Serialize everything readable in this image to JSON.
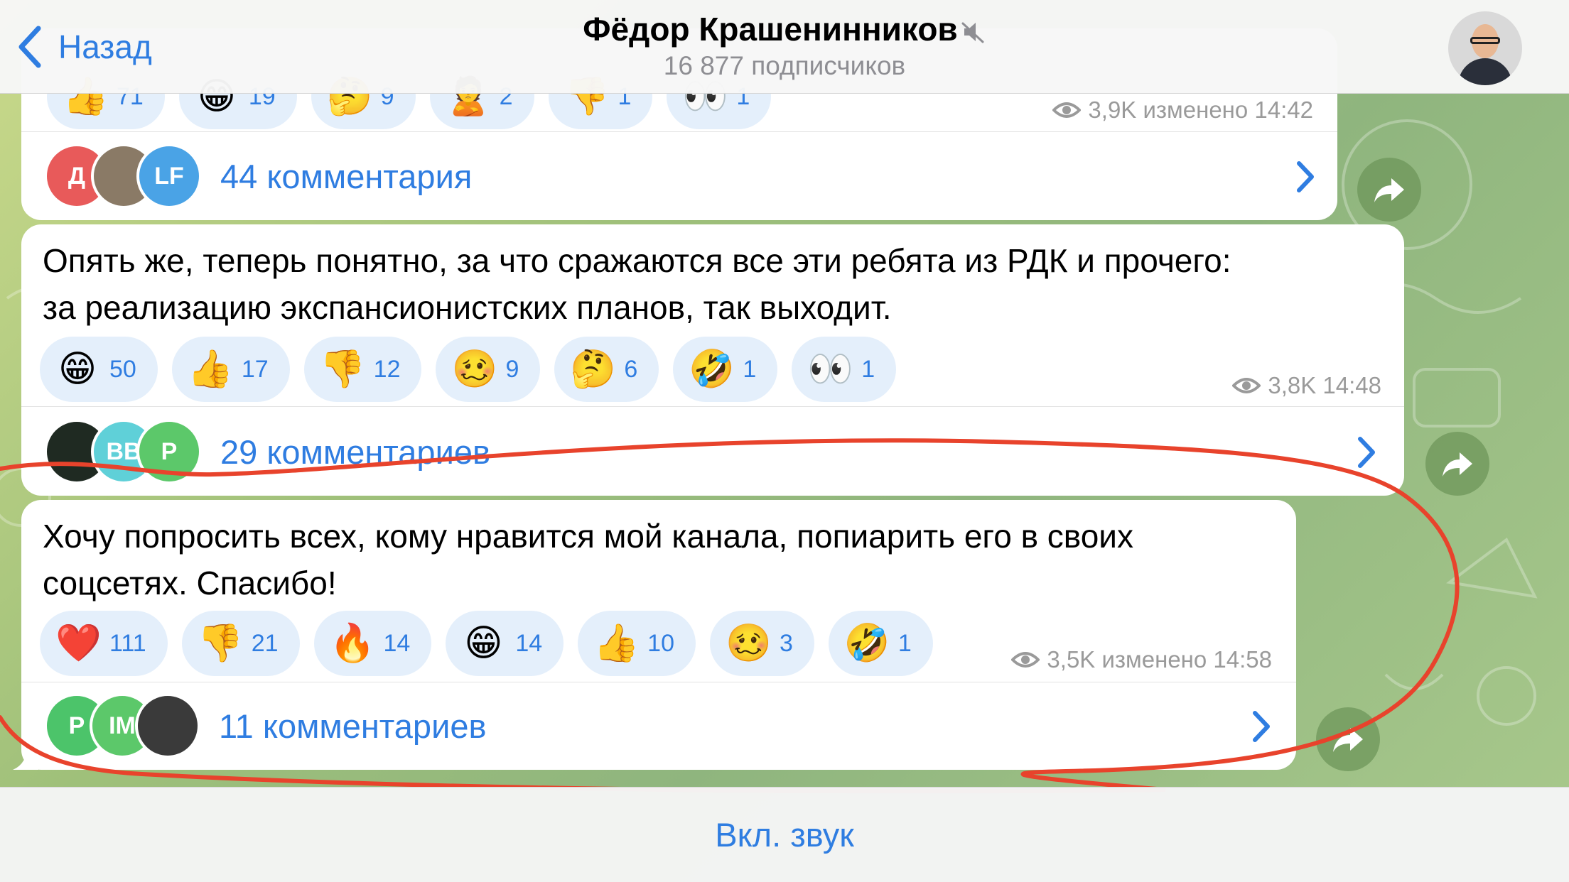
{
  "header": {
    "back_label": "Назад",
    "title": "Фёдор Крашенинников",
    "subtitle": "16 877 подписчиков",
    "muted_icon": "speaker-muted-icon"
  },
  "messages": [
    {
      "text_lines": [],
      "reactions": [
        {
          "emoji": "👍",
          "count": "71"
        },
        {
          "emoji": "😁",
          "count": "19"
        },
        {
          "emoji": "🤔",
          "count": "9"
        },
        {
          "emoji": "🙎",
          "count": "2"
        },
        {
          "emoji": "👎",
          "count": "1"
        },
        {
          "emoji": "👀",
          "count": "1"
        }
      ],
      "views": "3,9K",
      "time": "изменено 14:42",
      "comments_label": "44 комментария",
      "comment_avatars": [
        {
          "initials": "Д",
          "color": "#e85a5a"
        },
        {
          "initials": "",
          "color": "#7b6b5a"
        },
        {
          "initials": "LF",
          "color": "#4aa3e6"
        }
      ]
    },
    {
      "text_lines": [
        "Опять же, теперь понятно, за что сражаются все эти ребята из РДК и прочего:",
        "за реализацию экспансионистских планов, так выходит."
      ],
      "reactions": [
        {
          "emoji": "😁",
          "count": "50"
        },
        {
          "emoji": "👍",
          "count": "17"
        },
        {
          "emoji": "👎",
          "count": "12"
        },
        {
          "emoji": "🥴",
          "count": "9"
        },
        {
          "emoji": "🤔",
          "count": "6"
        },
        {
          "emoji": "🤣",
          "count": "1"
        },
        {
          "emoji": "👀",
          "count": "1"
        }
      ],
      "views": "3,8K",
      "time": "14:48",
      "comments_label": "29 комментариев",
      "comment_avatars": [
        {
          "initials": "",
          "color": "#1f2a22"
        },
        {
          "initials": "ВВ",
          "color": "#5fd0d8"
        },
        {
          "initials": "Р",
          "color": "#5cc86a"
        }
      ]
    },
    {
      "text_lines": [
        "Хочу попросить всех, кому нравится мой канала, попиарить его в своих",
        "соцсетях. Спасибо!"
      ],
      "reactions": [
        {
          "emoji": "❤️",
          "count": "111"
        },
        {
          "emoji": "👎",
          "count": "21"
        },
        {
          "emoji": "🔥",
          "count": "14"
        },
        {
          "emoji": "😁",
          "count": "14"
        },
        {
          "emoji": "👍",
          "count": "10"
        },
        {
          "emoji": "🥴",
          "count": "3"
        },
        {
          "emoji": "🤣",
          "count": "1"
        }
      ],
      "views": "3,5K",
      "time": "изменено 14:58",
      "comments_label": "11 комментариев",
      "comment_avatars": [
        {
          "initials": "Р",
          "color": "#4cc46a"
        },
        {
          "initials": "IM",
          "color": "#5cc86a"
        },
        {
          "initials": "",
          "color": "#3a3a3a"
        }
      ]
    }
  ],
  "bottom": {
    "unmute_label": "Вкл. звук"
  },
  "colors": {
    "accent": "#2f7de1",
    "annotation": "#e8432c",
    "reaction_bg": "#e4effb"
  }
}
